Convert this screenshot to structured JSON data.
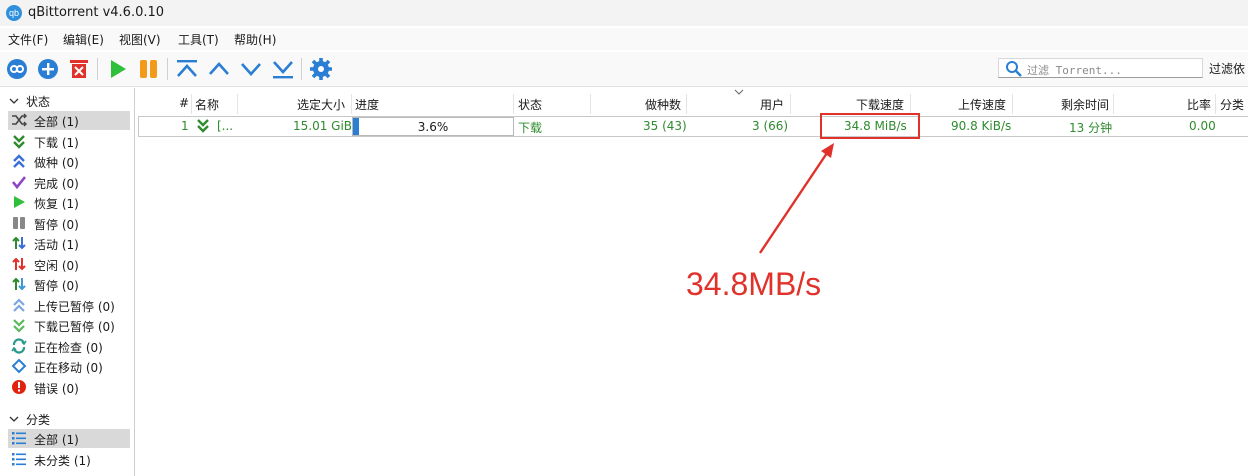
{
  "window": {
    "title": "qBittorrent v4.6.0.10",
    "icon_text": "qb"
  },
  "menu": [
    "文件(F)",
    "编辑(E)",
    "视图(V)",
    "工具(T)",
    "帮助(H)"
  ],
  "toolbar": {
    "buttons": [
      "add-link",
      "add-torrent",
      "remove",
      "resume",
      "pause",
      "move-top",
      "move-up",
      "move-down",
      "move-bottom",
      "options"
    ],
    "search_placeholder": "过滤 Torrent...",
    "filter_label": "过滤依"
  },
  "sidebar": {
    "status_header": "状态",
    "status_items": [
      {
        "label": "全部 (1)",
        "icon": "shuffle-icon",
        "selected": true
      },
      {
        "label": "下载 (1)",
        "icon": "download-icon"
      },
      {
        "label": "做种 (0)",
        "icon": "seeding-icon"
      },
      {
        "label": "完成 (0)",
        "icon": "check-icon"
      },
      {
        "label": "恢复 (1)",
        "icon": "resume-icon"
      },
      {
        "label": "暂停 (0)",
        "icon": "pause-icon"
      },
      {
        "label": "活动 (1)",
        "icon": "active-icon"
      },
      {
        "label": "空闲 (0)",
        "icon": "inactive-icon"
      },
      {
        "label": "暂停 (0)",
        "icon": "stalled-icon"
      },
      {
        "label": "上传已暂停 (0)",
        "icon": "upload-paused-icon"
      },
      {
        "label": "下载已暂停 (0)",
        "icon": "download-paused-icon"
      },
      {
        "label": "正在检查 (0)",
        "icon": "checking-icon"
      },
      {
        "label": "正在移动 (0)",
        "icon": "moving-icon"
      },
      {
        "label": "错误 (0)",
        "icon": "error-icon"
      }
    ],
    "category_header": "分类",
    "category_items": [
      {
        "label": "全部 (1)",
        "icon": "list-icon",
        "selected": true
      },
      {
        "label": "未分类 (1)",
        "icon": "list-icon"
      }
    ]
  },
  "table": {
    "headers": [
      "#",
      "名称",
      "选定大小",
      "进度",
      "状态",
      "做种数",
      "用户",
      "下载速度",
      "上传速度",
      "剩余时间",
      "比率",
      "分类"
    ],
    "rows": [
      {
        "num": "1",
        "name": "[...",
        "size": "15.01 GiB",
        "progress_text": "3.6%",
        "progress": 0.036,
        "status": "下载",
        "seeds": "35 (43)",
        "peers": "3 (66)",
        "down_speed": "34.8 MiB/s",
        "up_speed": "90.8 KiB/s",
        "eta": "13 分钟",
        "ratio": "0.00"
      }
    ]
  },
  "annotation": {
    "text": "34.8MB/s",
    "color": "#e0322b"
  },
  "colors": {
    "accent": "#2a7fd4",
    "green": "#2e8b2e",
    "red": "#e0322b"
  }
}
